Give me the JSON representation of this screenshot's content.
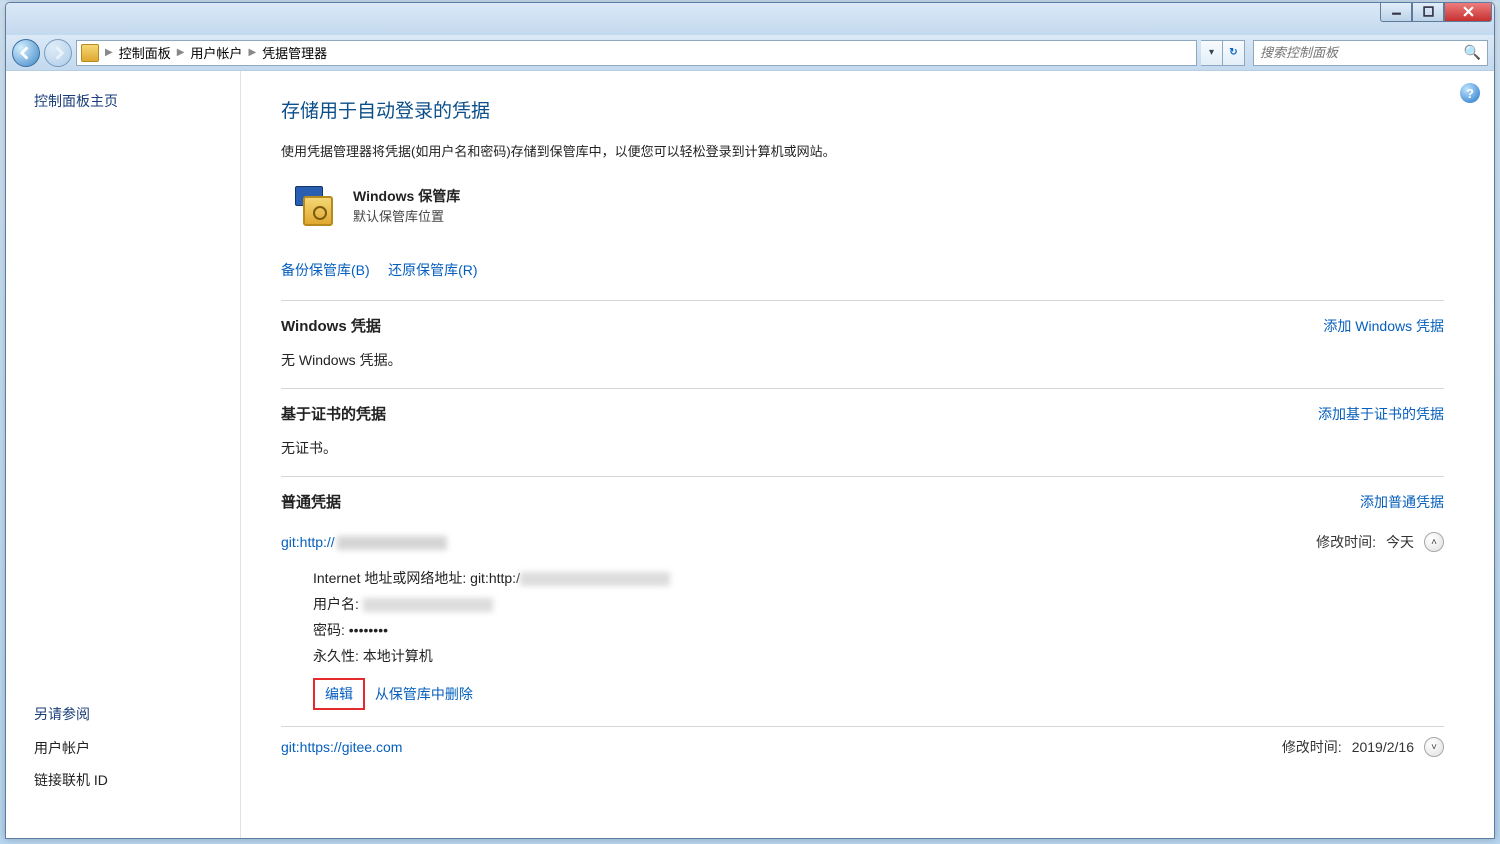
{
  "breadcrumbs": {
    "p1": "控制面板",
    "p2": "用户帐户",
    "p3": "凭据管理器"
  },
  "search": {
    "placeholder": "搜索控制面板"
  },
  "sidebar": {
    "home": "控制面板主页",
    "see_also": "另请参阅",
    "link1": "用户帐户",
    "link2": "链接联机 ID"
  },
  "main": {
    "title": "存储用于自动登录的凭据",
    "desc": "使用凭据管理器将凭据(如用户名和密码)存储到保管库中，以便您可以轻松登录到计算机或网站。",
    "vault_name": "Windows 保管库",
    "vault_loc": "默认保管库位置",
    "backup": "备份保管库(B)",
    "restore": "还原保管库(R)"
  },
  "sections": {
    "win": {
      "title": "Windows 凭据",
      "add": "添加 Windows 凭据",
      "empty": "无 Windows 凭据。"
    },
    "cert": {
      "title": "基于证书的凭据",
      "add": "添加基于证书的凭据",
      "empty": "无证书。"
    },
    "generic": {
      "title": "普通凭据",
      "add": "添加普通凭据"
    }
  },
  "cred1": {
    "name_prefix": "git:http://",
    "modified_label": "修改时间:",
    "modified_value": "今天",
    "addr_label": "Internet 地址或网络地址:",
    "addr_value_prefix": "git:http:/",
    "user_label": "用户名",
    "pass_label": "密码:",
    "pass_value": "••••••••",
    "persist_label": "永久性:",
    "persist_value": "本地计算机",
    "edit": "编辑",
    "remove": "从保管库中删除"
  },
  "cred2": {
    "name": "git:https://gitee.com",
    "modified_label": "修改时间:",
    "modified_value": "2019/2/16"
  }
}
